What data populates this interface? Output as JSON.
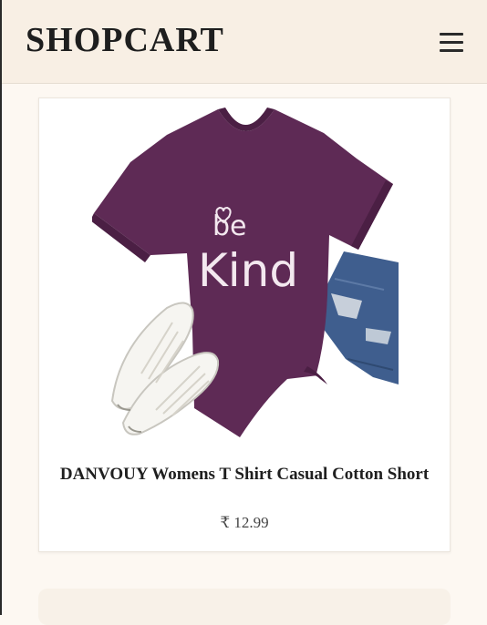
{
  "header": {
    "logo": "SHOPCART",
    "menu_icon": "hamburger-menu-icon"
  },
  "product": {
    "image_icon": "product-tshirt-image",
    "image_print_text": [
      "be",
      "Kind"
    ],
    "title": "DANVOUY Womens T Shirt Casual Cotton Short",
    "price": "₹ 12.99"
  },
  "colors": {
    "header_bg": "#f8efe4",
    "page_bg": "#fdf8f2",
    "shirt": "#5e2a55",
    "jeans": "#3f5e8e"
  }
}
